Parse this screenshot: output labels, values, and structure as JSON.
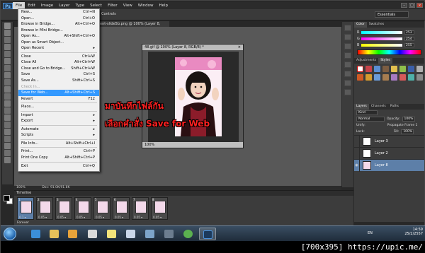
{
  "menubar": {
    "logo": "Ps",
    "items": [
      "File",
      "Edit",
      "Image",
      "Layer",
      "Type",
      "Select",
      "Filter",
      "View",
      "Window",
      "Help"
    ]
  },
  "optbar": {
    "text": "Controls",
    "workspace": "Essentials"
  },
  "doc_tab": "ent-slide5b.png @ 100% (Layer 8, RGB/8)",
  "file_menu": {
    "items": [
      {
        "label": "New...",
        "shortcut": "Ctrl+N"
      },
      {
        "label": "Open...",
        "shortcut": "Ctrl+O"
      },
      {
        "label": "Browse in Bridge...",
        "shortcut": "Alt+Ctrl+O"
      },
      {
        "label": "Browse in Mini Bridge...",
        "shortcut": ""
      },
      {
        "label": "Open As...",
        "shortcut": "Alt+Shift+Ctrl+O"
      },
      {
        "label": "Open as Smart Object...",
        "shortcut": ""
      },
      {
        "label": "Open Recent",
        "shortcut": "▸"
      },
      {
        "label": "Close",
        "shortcut": "Ctrl+W"
      },
      {
        "label": "Close All",
        "shortcut": "Alt+Ctrl+W"
      },
      {
        "label": "Close and Go to Bridge...",
        "shortcut": "Shift+Ctrl+W"
      },
      {
        "label": "Save",
        "shortcut": "Ctrl+S"
      },
      {
        "label": "Save As...",
        "shortcut": "Shift+Ctrl+S"
      },
      {
        "label": "Check In...",
        "shortcut": ""
      },
      {
        "label": "Save for Web...",
        "shortcut": "Alt+Shift+Ctrl+S"
      },
      {
        "label": "Revert",
        "shortcut": "F12"
      },
      {
        "label": "Place...",
        "shortcut": ""
      },
      {
        "label": "Import",
        "shortcut": "▸"
      },
      {
        "label": "Export",
        "shortcut": "▸"
      },
      {
        "label": "Automate",
        "shortcut": "▸"
      },
      {
        "label": "Scripts",
        "shortcut": "▸"
      },
      {
        "label": "File Info...",
        "shortcut": "Alt+Shift+Ctrl+I"
      },
      {
        "label": "Print...",
        "shortcut": "Ctrl+P"
      },
      {
        "label": "Print One Copy",
        "shortcut": "Alt+Shift+Ctrl+P"
      },
      {
        "label": "Exit",
        "shortcut": "Ctrl+Q"
      }
    ]
  },
  "doc_window": {
    "title": "48.gif @ 100% (Layer 8, RGB/8) *",
    "zoom": "100%"
  },
  "annotation": {
    "line1": "มาบันทึกไฟล์กัน",
    "line2": "เลือกคำสั่ง Save for Web"
  },
  "panels": {
    "color_tabs": [
      "Color",
      "Swatches"
    ],
    "rgb": [
      {
        "label": "R",
        "value": "253"
      },
      {
        "label": "G",
        "value": "254"
      },
      {
        "label": "B",
        "value": "255"
      }
    ],
    "adjust_tabs": [
      "Adjustments",
      "Styles"
    ],
    "layer_tabs": [
      "Layers",
      "Channels",
      "Paths"
    ],
    "kind": "Kind",
    "blend_mode": "Normal",
    "opacity_label": "Opacity:",
    "opacity_value": "100%",
    "unify_label": "Unify:",
    "propagate": "Propagate Frame 1",
    "lock_label": "Lock:",
    "fill_label": "Fill:",
    "fill_value": "100%",
    "layers": [
      {
        "name": "Layer 3",
        "selected": false
      },
      {
        "name": "Layer 2",
        "selected": false
      },
      {
        "name": "Layer 8",
        "selected": true
      }
    ]
  },
  "status": {
    "zoom": "100%",
    "doc": "Doc: 91.0K/91.8K"
  },
  "timeline": {
    "title": "Timeline",
    "frames": [
      {
        "num": "1",
        "dur": "0.1 ▾"
      },
      {
        "num": "2",
        "dur": "0.05 ▾"
      },
      {
        "num": "3",
        "dur": "0.05 ▾"
      },
      {
        "num": "4",
        "dur": "0.05 ▾"
      },
      {
        "num": "5",
        "dur": "0.05 ▾"
      },
      {
        "num": "6",
        "dur": "0.05 ▾"
      },
      {
        "num": "7",
        "dur": "0.05 ▾"
      },
      {
        "num": "8",
        "dur": "0.05 ▾"
      }
    ],
    "loop": "Forever"
  },
  "taskbar": {
    "lang": "EN",
    "time": "14:59",
    "date": "25/2/2557"
  },
  "watermark": "[700x395] https://upic.me/",
  "colors": {
    "menu_highlight": "#3399ff",
    "annotation": "#ff2020",
    "layer_selected": "#5d7fa8"
  }
}
